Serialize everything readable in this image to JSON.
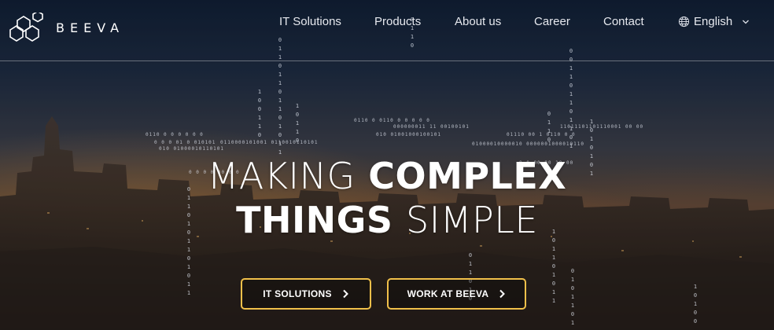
{
  "header": {
    "brand": "BEEVA",
    "nav": [
      {
        "label": "IT Solutions"
      },
      {
        "label": "Products"
      },
      {
        "label": "About us"
      },
      {
        "label": "Career"
      },
      {
        "label": "Contact"
      }
    ],
    "language": {
      "label": "English",
      "icon": "globe-icon",
      "dropdown_icon": "chevron-down-icon"
    }
  },
  "hero": {
    "headline_line1_light": "MAKING",
    "headline_line1_bold": "COMPLEX",
    "headline_line2_bold": "THINGS",
    "headline_line2_light": "SIMPLE",
    "buttons": [
      {
        "label": "IT SOLUTIONS",
        "icon": "chevron-right-icon"
      },
      {
        "label": "WORK AT BEEVA",
        "icon": "chevron-right-icon"
      }
    ]
  },
  "colors": {
    "accent": "#f1c04a",
    "text": "#ffffff",
    "header_divider": "#ffffff"
  }
}
